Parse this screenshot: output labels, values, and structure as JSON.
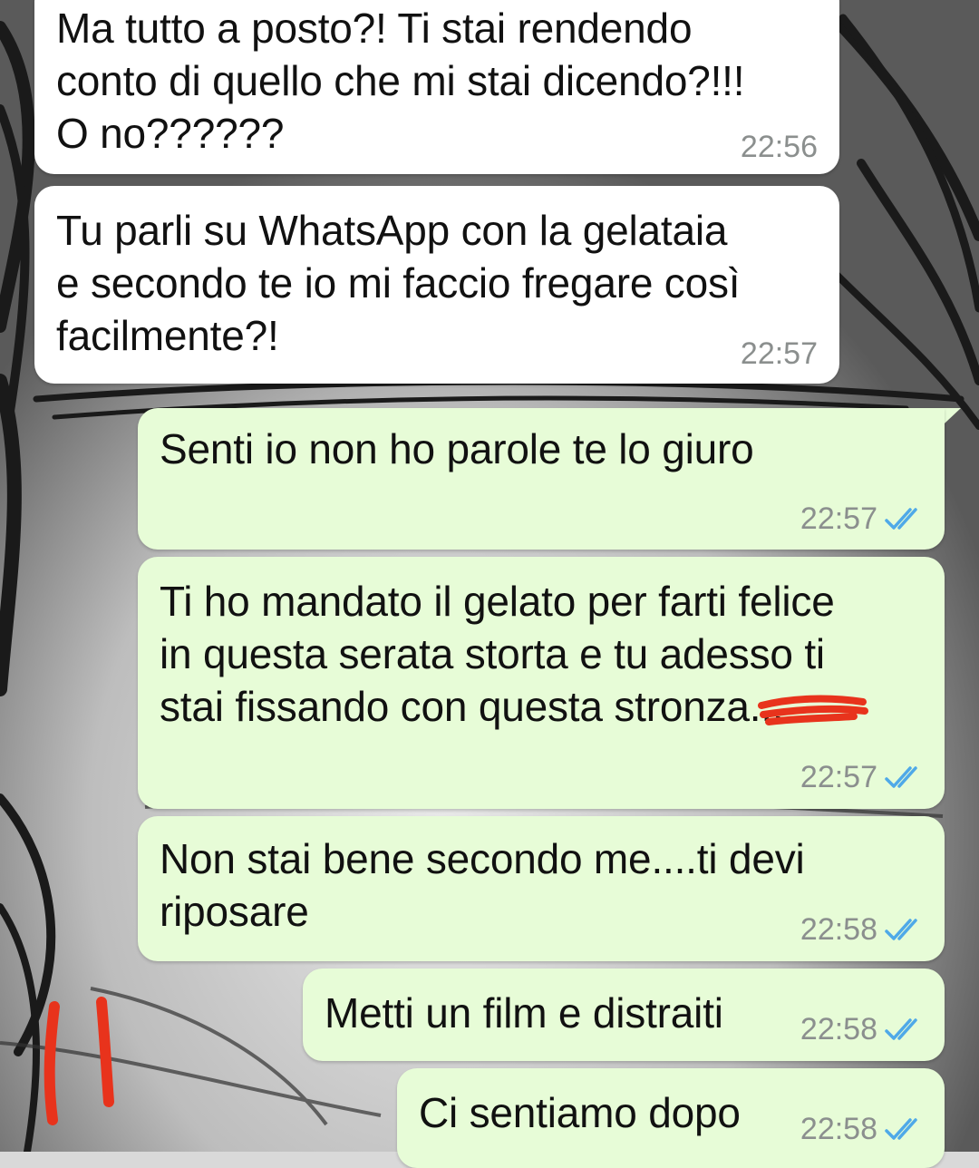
{
  "chat": {
    "messages": [
      {
        "direction": "incoming",
        "text": "Ma tutto a posto?! Ti stai rendendo\nconto di quello che mi stai dicendo?!!!\nO no??????",
        "time": "22:56"
      },
      {
        "direction": "incoming",
        "text": "Tu parli su WhatsApp con la gelataia\ne secondo te io mi faccio fregare così\nfacilmente?!",
        "time": "22:57"
      },
      {
        "direction": "outgoing",
        "text": "Senti io non ho parole te lo giuro",
        "time": "22:57",
        "status": "read"
      },
      {
        "direction": "outgoing",
        "text": "Ti ho mandato il gelato per farti felice\nin questa serata storta e tu adesso ti\nstai fissando con questa stronza...",
        "time": "22:57",
        "status": "read"
      },
      {
        "direction": "outgoing",
        "text": "Non stai bene secondo me....ti devi\nriposare",
        "time": "22:58",
        "status": "read"
      },
      {
        "direction": "outgoing",
        "text": "Metti un film e distraiti",
        "time": "22:58",
        "status": "read"
      },
      {
        "direction": "outgoing",
        "text": "Ci sentiamo dopo",
        "time": "22:58",
        "status": "read"
      }
    ]
  },
  "icons": {
    "read_receipt": "double-check-icon"
  },
  "colors": {
    "incoming_bubble": "#ffffff",
    "outgoing_bubble": "#e7fcd7",
    "read_ticks": "#4fa9e8",
    "timestamp": "#8b8f8e",
    "redaction_mark": "#e8331c"
  }
}
